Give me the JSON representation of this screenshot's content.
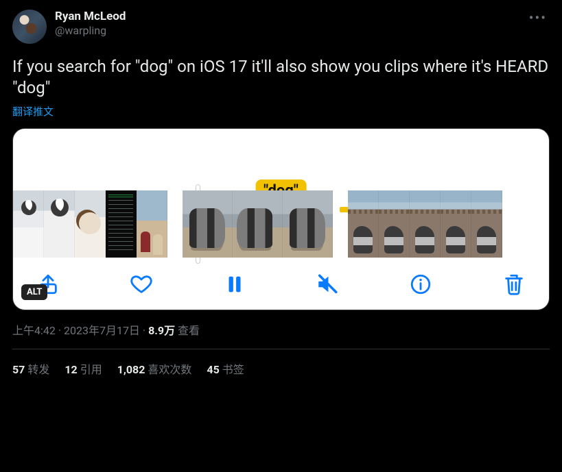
{
  "author": {
    "displayName": "Ryan McLeod",
    "handle": "@warpling"
  },
  "tweetText": "If you search for \"dog\" on iOS 17 it'll also show you clips where it's HEARD \"dog\"",
  "translateLabel": "翻译推文",
  "media": {
    "captionPill": "\"dog\"",
    "altBadge": "ALT"
  },
  "meta": {
    "time": "上午4:42",
    "separator1": " · ",
    "date": "2023年7月17日",
    "separator2": " · ",
    "viewsCount": "8.9万",
    "viewsLabel": " 查看"
  },
  "stats": {
    "retweets": {
      "count": "57",
      "label": "转发"
    },
    "quotes": {
      "count": "12",
      "label": "引用"
    },
    "likes": {
      "count": "1,082",
      "label": "喜欢次数"
    },
    "bookmarks": {
      "count": "45",
      "label": "书签"
    }
  }
}
